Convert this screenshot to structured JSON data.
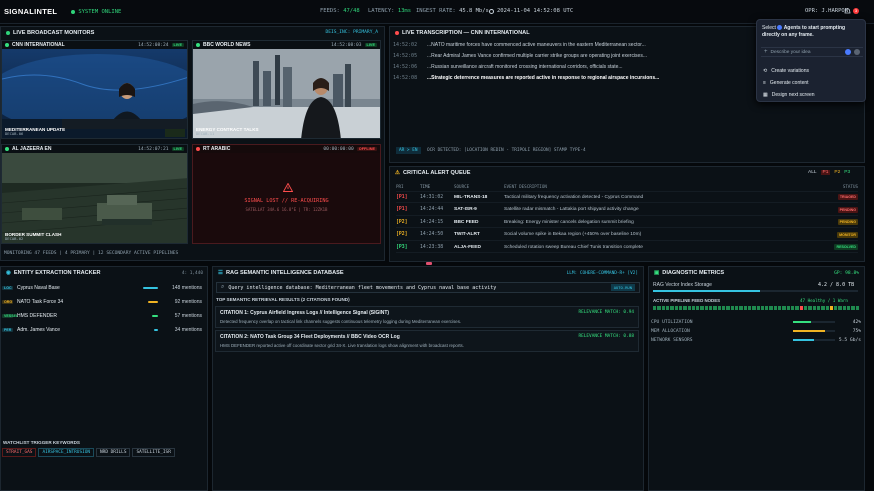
{
  "topbar": {
    "brand": "SIGNALINTEL",
    "status": "SYSTEM ONLINE",
    "feeds_label": "FEEDS:",
    "feeds_value": "47/48",
    "latency_label": "LATENCY:",
    "latency_value": "13ms",
    "ingest_label": "INGEST RATE:",
    "ingest_value": "45.8 Mb/s",
    "clock": "2024-11-04 14:52:08 UTC",
    "operator": "OPR: J.HARPON",
    "notif_count": "3"
  },
  "monitors": {
    "title": "LIVE BROADCAST MONITORS",
    "sync": "DEIS_INC: PRIMARY_A",
    "footer": "MONITORING 47 FEEDS | 4 PRIMARY | 12 SECONDARY ACTIVE PIPELINES",
    "feeds": [
      {
        "name": "CNN INTERNATIONAL",
        "time": "14:52:08:24",
        "tag": "LIVE",
        "caption": "MEDITERRANEAN UPDATE",
        "sub": "DECAB.06"
      },
      {
        "name": "BBC WORLD NEWS",
        "time": "14:52:08:03",
        "tag": "LIVE",
        "caption": "ENERGY CONTRACT TALKS",
        "sub": "DECAB.11"
      },
      {
        "name": "AL JAZEERA EN",
        "time": "14:52:07:21",
        "tag": "LIVE",
        "caption": "BORDER SUMMIT CLASH",
        "sub": "DECAB.02"
      },
      {
        "name": "RT ARABIC",
        "time": "00:00:00:00",
        "tag": "OFFLINE",
        "lost": "SIGNAL LOST // RE-ACQUIRING",
        "lost_sub": "SATELLAT 34A.6 16.8°E | TR: 12ZK1B"
      }
    ]
  },
  "transcript": {
    "title": "LIVE TRANSCRIPTION — CNN INTERNATIONAL",
    "lines": [
      {
        "t": "14:52:02",
        "text": "...NATO maritime forces have commenced active maneuvers in the eastern Mediterranean sector..."
      },
      {
        "t": "14:52:05",
        "text": "...Rear Admiral James Vance confirmed multiple carrier strike groups are operating joint exercises..."
      },
      {
        "t": "14:52:06",
        "text": "...Russian surveillance aircraft monitored crossing international corridors, officials state..."
      },
      {
        "t": "14:52:08",
        "text": "...Strategic deterrence measures are reported active in response to regional airspace incursions..."
      }
    ],
    "chips": [
      "AR > EN"
    ],
    "ocr": "OCR DETECTED: [LOCATION REDIN - TRIPOLI REGION] STAMP TYPE-4"
  },
  "alerts": {
    "title": "CRITICAL ALERT QUEUE",
    "filters": [
      "ALL",
      "P1",
      "P2",
      "P3"
    ],
    "headers": [
      "PRI",
      "TIME",
      "SOURCE",
      "EVENT DESCRIPTION",
      "STATUS"
    ],
    "rows": [
      {
        "pri": "[P1]",
        "time": "14:31:02",
        "src": "MIL-TRANS-18",
        "desc": "Tactical military frequency activation detected - Cyprus Command",
        "status": "TRIAGED",
        "color": "#ff4d4d",
        "sbg": "#4a1414",
        "sc": "#ff6b6b"
      },
      {
        "pri": "[P1]",
        "time": "14:24:44",
        "src": "SAT-ISR-9",
        "desc": "Satellite radar mismatch - Lattakia port shipyard activity change",
        "status": "PENDING",
        "color": "#ff4d4d",
        "sbg": "#4a1414",
        "sc": "#ff6b6b"
      },
      {
        "pri": "[P2]",
        "time": "14:24:15",
        "src": "BBC FEED",
        "desc": "Breaking: Energy minister cancels delegation summit briefing",
        "status": "PENDING",
        "color": "#f0b323",
        "sbg": "#4a3a0a",
        "sc": "#f0b323"
      },
      {
        "pri": "[P2]",
        "time": "14:24:50",
        "src": "TWIT-ALRT",
        "desc": "Social volume spike in Bekaa region (+450% over baseline 10m)",
        "status": "MONITOR",
        "color": "#f0b323",
        "sbg": "#4a3a0a",
        "sc": "#f0b323"
      },
      {
        "pri": "[P3]",
        "time": "14:23:38",
        "src": "ALJA-FEED",
        "desc": "Scheduled rotation sweep Bureau Chief Tunis transition complete",
        "status": "RESOLVED",
        "color": "#35e07f",
        "sbg": "#0f3a22",
        "sc": "#35e07f"
      }
    ]
  },
  "entities": {
    "title": "ENTITY EXTRACTION TRACKER",
    "count": "4: 1,440",
    "items": [
      {
        "tag": "LOC",
        "name": "Cyprus Naval Base",
        "count": "148 mentions",
        "color": "#35c3e0",
        "fill": 0.95
      },
      {
        "tag": "ORG",
        "name": "NATO Task Force 34",
        "count": "92 mentions",
        "color": "#f0b323",
        "fill": 0.6
      },
      {
        "tag": "VESSEL",
        "name": "HMS DEFENDER",
        "count": "57 mentions",
        "color": "#35e07f",
        "fill": 0.37
      },
      {
        "tag": "PER",
        "name": "Adm. James Vance",
        "count": "34 mentions",
        "color": "#35c3e0",
        "fill": 0.22
      }
    ],
    "watch_title": "WATCHLIST TRIGGER KEYWORDS",
    "keywords": [
      "STRAIT_GAS",
      "AIRSPACE_INTRUSION",
      "NRD DRILLS",
      "SATELLITE_ISR"
    ]
  },
  "rag": {
    "title": "RAG SEMANTIC INTELLIGENCE DATABASE",
    "model": "LLM: COHERE-COMMAND-R+ [V2]",
    "query": "Query intelligence database: Mediterranean fleet movements and Cyprus naval base activity",
    "btn": "AUTO-RUN",
    "results": "TOP SEMANTIC RETRIEVAL RESULTS (2 CITATIONS FOUND)",
    "citations": [
      {
        "title": "CITATION 1: Cyprus Airfield Ingress Logs // Intelligence Signal (SIGINT)",
        "match": "RELEVANCE MATCH: 0.94",
        "text": "Detected frequency overlap on tactical link channels suggests continuous telemetry logging during Mediterranean exercises."
      },
      {
        "title": "CITATION 2: NATO Task Group 34 Fleet Deployments // BBC Video OCR Log",
        "match": "RELEVANCE MATCH: 0.88",
        "text": "HMS DEFENDER reported active off coordinate sector grid 34-X. Live translation logs show alignment with broadcast reports."
      }
    ]
  },
  "diag": {
    "title": "DIAGNOSTIC METRICS",
    "gpu": "GP: 98.8%",
    "storage_label": "RAG Vector Index Storage",
    "storage_value": "4.2 / 8.0 TB",
    "storage_fill": 0.52,
    "pipes_label": "ACTIVE PIPELINE FEED NODES",
    "pipes_value": "47 Healthy / 1 Warn",
    "metrics": [
      {
        "label": "CPU UTILIZATION",
        "value": "42%",
        "fill": 0.42,
        "color": "#35e07f"
      },
      {
        "label": "MEM ALLOCATION",
        "value": "75%",
        "fill": 0.75,
        "color": "#f0b323"
      },
      {
        "label": "NETWORK SENSORS",
        "value": "5.5 Gb/s",
        "fill": 0.5,
        "color": "#35c3e0"
      }
    ]
  },
  "popup": {
    "text_pre": "Select",
    "text_post": "Agents to start prompting directly on any frame.",
    "placeholder": "Describe your idea",
    "items": [
      "Create variations",
      "Generate content",
      "Design next screen"
    ]
  }
}
